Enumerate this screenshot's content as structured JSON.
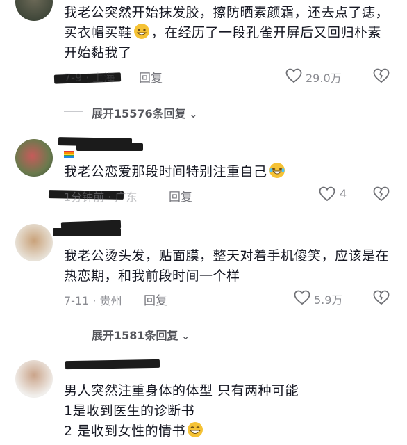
{
  "comments": [
    {
      "text": "我老公突然开始抹发胶，擦防晒素颜霜，还去点了痣，买衣帽买鞋",
      "text_tail": "，在经历了一段孔雀开屏后又回归朴素开始黏我了",
      "emoji": "grin-emoji",
      "meta": "7-9 · 上海",
      "reply": "回复",
      "likes": "29.0万",
      "expand": "展开15576条回复"
    },
    {
      "text": "我老公恋爱那段时间特别注重自己",
      "emoji": "laughing-tears-emoji",
      "meta": "1分钟前 · 广东",
      "reply": "回复",
      "likes": "4"
    },
    {
      "text": "我老公烫头发，贴面膜，整天对着手机傻笑，应该是在热恋期，和我前段时间一个样",
      "meta": "7-11 · 贵州",
      "reply": "回复",
      "likes": "5.9万",
      "expand": "展开1581条回复"
    },
    {
      "text_line1": "男人突然注重身体的体型 只有两种可能",
      "text_line2": "1是收到医生的诊断书",
      "text_line3": "2 是收到女性的情书",
      "emoji": "grin-emoji"
    }
  ],
  "colors": {
    "text": "#161823",
    "meta": "#8a8b91",
    "redaction": "#1b1b1b"
  }
}
